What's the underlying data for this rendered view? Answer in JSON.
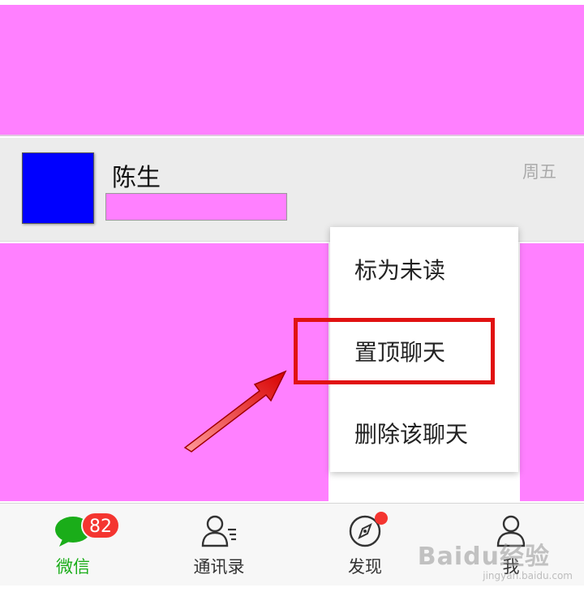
{
  "chat": {
    "name": "陈生",
    "time": "周五"
  },
  "context_menu": {
    "items": [
      "标为未读",
      "置顶聊天",
      "删除该聊天"
    ],
    "highlighted": "置顶聊天"
  },
  "tabs": [
    {
      "label": "微信",
      "icon": "chat-bubble-icon",
      "active": true,
      "badge": "82"
    },
    {
      "label": "通讯录",
      "icon": "contacts-icon",
      "active": false
    },
    {
      "label": "发现",
      "icon": "compass-icon",
      "active": false,
      "dot": true
    },
    {
      "label": "我",
      "icon": "person-icon",
      "active": false
    }
  ],
  "watermark": {
    "text": "Baidu经验",
    "sub": "jingyan.baidu.com"
  },
  "colors": {
    "accent": "#1aad19",
    "badge": "#f43530",
    "highlight": "#e11212",
    "redaction": "#ff80ff",
    "avatar": "#0000ff"
  }
}
